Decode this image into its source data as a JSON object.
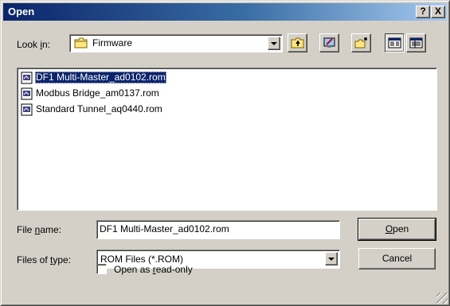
{
  "window": {
    "title": "Open",
    "help_button": "?",
    "close_button": "X"
  },
  "lookin": {
    "label_prefix": "Look ",
    "label_accel": "i",
    "label_suffix": "n:",
    "folder": "Firmware",
    "folder_icon": "folder-icon"
  },
  "toolbar": {
    "icons": [
      "up-one-level-icon",
      "desktop-icon",
      "new-folder-icon",
      "list-view-icon",
      "details-view-icon"
    ]
  },
  "files": [
    {
      "name": "DF1 Multi-Master_ad0102.rom",
      "selected": true,
      "icon": "rom-file-icon"
    },
    {
      "name": "Modbus Bridge_am0137.rom",
      "selected": false,
      "icon": "rom-file-icon"
    },
    {
      "name": "Standard Tunnel_aq0440.rom",
      "selected": false,
      "icon": "rom-file-icon"
    }
  ],
  "filename": {
    "label_prefix": "File ",
    "label_accel": "n",
    "label_suffix": "ame:",
    "value": "DF1 Multi-Master_ad0102.rom"
  },
  "filetype": {
    "label_prefix": "Files of ",
    "label_accel": "t",
    "label_suffix": "ype:",
    "value": "ROM Files (*.ROM)"
  },
  "buttons": {
    "open_accel": "O",
    "open_rest": "pen",
    "cancel": "Cancel"
  },
  "readonly": {
    "label_prefix": "Open as ",
    "label_accel": "r",
    "label_suffix": "ead-only",
    "checked": false
  },
  "colors": {
    "title_start": "#0a246a",
    "title_end": "#a6caf0",
    "face": "#d4d0c8",
    "selection": "#0a246a"
  }
}
